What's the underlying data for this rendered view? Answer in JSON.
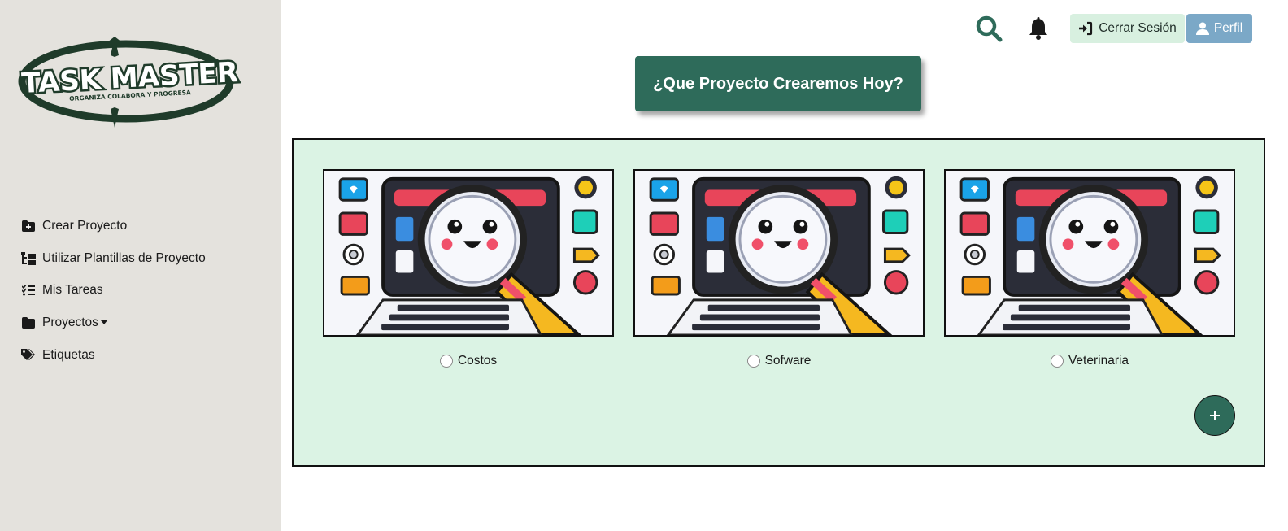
{
  "sidebar": {
    "logo": {
      "title": "TASK MASTER",
      "tagline": "ORGANIZA COLABORA Y PROGRESA"
    },
    "items": [
      {
        "label": "Crear Proyecto",
        "icon": "folder-plus-icon"
      },
      {
        "label": "Utilizar Plantillas de Proyecto",
        "icon": "folder-tree-icon"
      },
      {
        "label": "Mis Tareas",
        "icon": "list-check-icon"
      },
      {
        "label": "Proyectos",
        "icon": "folder-icon",
        "dropdown": true
      },
      {
        "label": "Etiquetas",
        "icon": "tags-icon"
      }
    ]
  },
  "topbar": {
    "logout_label": "Cerrar Sesión",
    "profile_label": "Perfil"
  },
  "main": {
    "hero_button": "¿Que Proyecto Crearemos Hoy?",
    "projects": [
      {
        "name": "Costos"
      },
      {
        "name": "Sofware"
      },
      {
        "name": "Veterinaria"
      }
    ]
  },
  "colors": {
    "accent": "#2e6b5a",
    "panel_bg": "#dbf3e4",
    "sidebar_bg": "#e4e2dd",
    "profile_btn": "#7ba8c7",
    "logout_btn": "#d8f0e0"
  }
}
